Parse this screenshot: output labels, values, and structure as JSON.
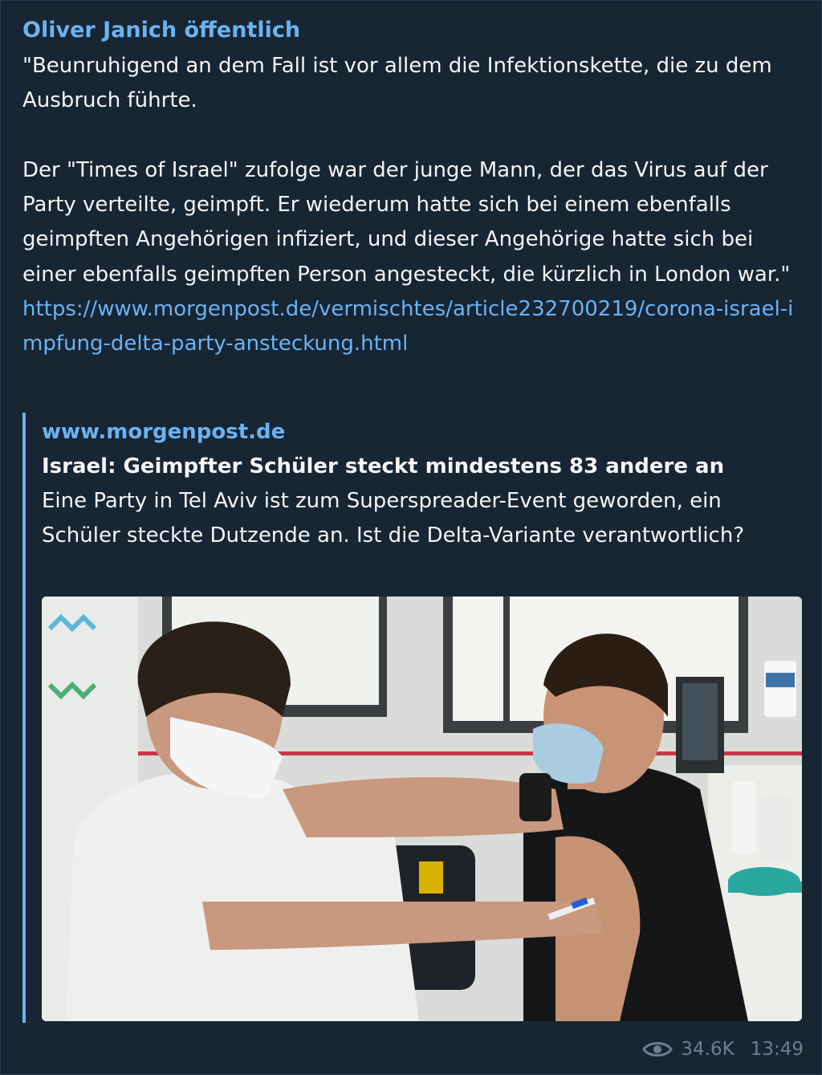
{
  "post": {
    "sender": "Oliver Janich öffentlich",
    "paragraph1": "\"Beunruhigend an dem Fall ist vor allem die Infektionskette, die zu dem Ausbruch führte.",
    "paragraph2": "Der \"Times of Israel\" zufolge war der junge Mann, der das Virus auf der Party verteilte, geimpft. Er wiederum hatte sich bei einem ebenfalls geimpften Angehörigen infiziert, und dieser Angehörige hatte sich bei einer ebenfalls geimpften Person angesteckt, die kürzlich in London war.\"",
    "link": "https://www.morgenpost.de/vermischtes/article232700219/corona-israel-impfung-delta-party-ansteckung.html"
  },
  "preview": {
    "site": "www.morgenpost.de",
    "title": "Israel: Geimpfter Schüler steckt mindestens 83 andere an",
    "description": "Eine Party in Tel Aviv ist zum Superspreader-Event geworden, ein Schüler steckte Dutzende an. Ist die Delta-Variante verantwortlich?"
  },
  "meta": {
    "views": "34.6K",
    "time": "13:49",
    "icon": "eye-icon"
  },
  "colors": {
    "background": "#182533",
    "accent": "#6ab3f3",
    "text": "#f5f5f5",
    "muted": "#6d7f8f"
  }
}
